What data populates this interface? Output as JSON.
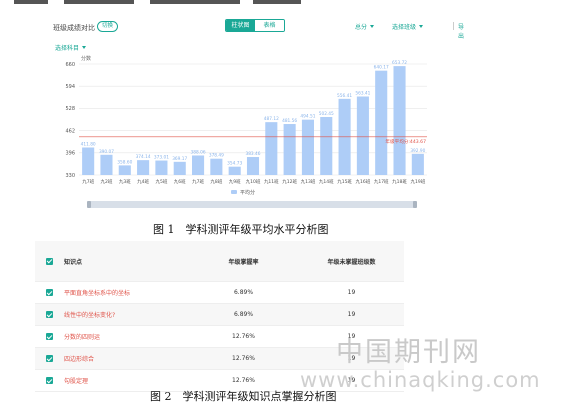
{
  "header": {
    "title": "班级成绩对比",
    "badge": "切换",
    "toggle": {
      "active": "柱状图",
      "inactive": "表格"
    },
    "dropdowns": {
      "score_type": "总分",
      "class_select": "选择班级",
      "subject": "选择科目"
    },
    "export_label": "导出"
  },
  "captions": {
    "fig1": "图 1　学科测评年级平均水平分析图",
    "fig2": "图 2　学科测评年级知识点掌握分析图"
  },
  "chart_data": {
    "type": "bar",
    "ylabel": "分数",
    "ylim": [
      330,
      660
    ],
    "yticks": [
      330,
      396,
      462,
      528,
      594,
      660
    ],
    "grid": true,
    "categories": [
      "九7班",
      "九2班",
      "九3班",
      "九4班",
      "九5班",
      "九6班",
      "九7班",
      "九8班",
      "九9班",
      "九10班",
      "九11班",
      "九12班",
      "九13班",
      "九14班",
      "九15班",
      "九16班",
      "九17班",
      "九18班",
      "九19班"
    ],
    "series": [
      {
        "name": "平均分",
        "values": [
          411.8,
          390.07,
          358.6,
          374.14,
          373.01,
          369.17,
          388.06,
          378.49,
          354.73,
          383.46,
          487.12,
          481.56,
          494.51,
          502.45,
          556.41,
          563.41,
          640.17,
          653.72,
          392.9
        ]
      }
    ],
    "reference_line": {
      "label": "年级平均分:443.67",
      "value": 443.67
    },
    "legend_position": "bottom-center",
    "bar_color": "#aecdf7"
  },
  "table": {
    "headers": [
      "知识点",
      "年级掌握率",
      "年级未掌握班级数"
    ],
    "rows": [
      {
        "name": "平面直角坐标系中的坐标",
        "rate": "6.89%",
        "count": "19"
      },
      {
        "name": "线性中的坐标变化?",
        "rate": "6.89%",
        "count": "19"
      },
      {
        "name": "分数的四则运",
        "rate": "12.76%",
        "count": "19"
      },
      {
        "name": "四边形综合",
        "rate": "12.76%",
        "count": "19"
      },
      {
        "name": "勾股定理",
        "rate": "12.76%",
        "count": "19"
      }
    ]
  },
  "watermark": {
    "cn": "中国期刊网",
    "en": "www.chinaqking.com"
  },
  "colors": {
    "accent": "#1aa896",
    "bar": "#aecdf7",
    "reference": "#e0544a",
    "knowledge_link": "#e0544a"
  }
}
